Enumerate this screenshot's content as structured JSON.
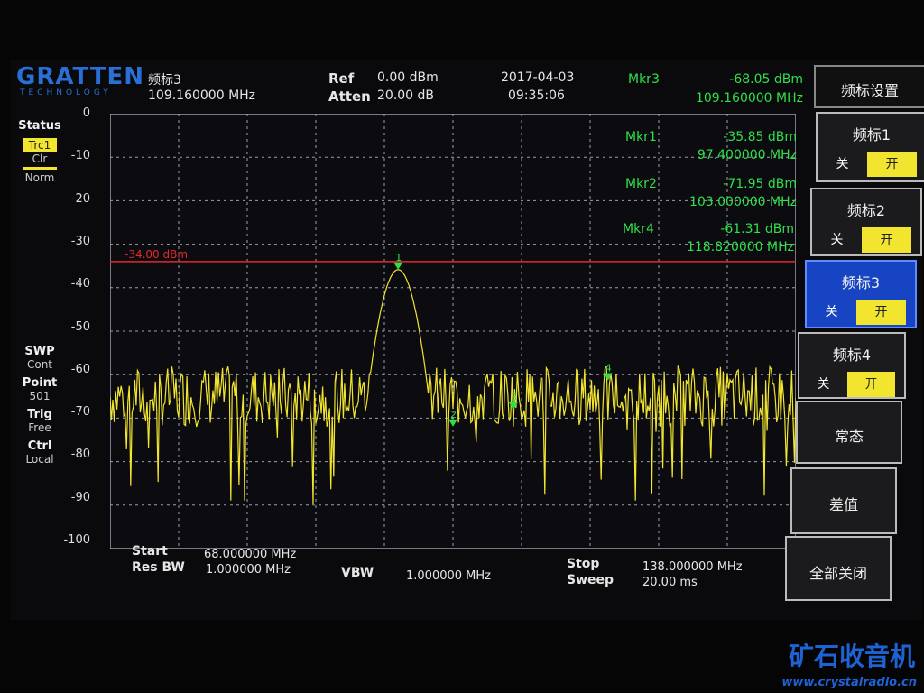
{
  "logo": {
    "main": "GRATTEN",
    "sub": "TECHNOLOGY"
  },
  "header": {
    "marker_name": "频标3",
    "marker_freq": "109.160000 MHz",
    "ref_label": "Ref",
    "ref_value": "0.00 dBm",
    "atten_label": "Atten",
    "atten_value": "20.00 dB",
    "date": "2017-04-03",
    "time": "09:35:06",
    "mkr3_label": "Mkr3",
    "mkr3_amp": "-68.05 dBm",
    "mkr3_freq": "109.160000 MHz"
  },
  "markers_table": [
    {
      "label": "Mkr1",
      "amp": "-35.85 dBm",
      "freq": "97.400000 MHz"
    },
    {
      "label": "Mkr2",
      "amp": "-71.95 dBm",
      "freq": "103.000000 MHz"
    },
    {
      "label": "Mkr4",
      "amp": "-61.31 dBm",
      "freq": "118.820000 MHz"
    }
  ],
  "left_panel": {
    "status": "Status",
    "trace": "Trc1",
    "clr": "Clr",
    "norm": "Norm",
    "swp_label": "SWP",
    "swp_value": "Cont",
    "point_label": "Point",
    "point_value": "501",
    "trig_label": "Trig",
    "trig_value": "Free",
    "ctrl_label": "Ctrl",
    "ctrl_value": "Local"
  },
  "y_ticks": [
    "0",
    "-10",
    "-20",
    "-30",
    "-40",
    "-50",
    "-60",
    "-70",
    "-80",
    "-90",
    "-100"
  ],
  "threshold_label": "-34.00 dBm",
  "footer": {
    "start_label": "Start",
    "start_value": "68.000000 MHz",
    "rbw_label": "Res BW",
    "rbw_value": "1.000000 MHz",
    "vbw_label": "VBW",
    "vbw_value": "1.000000 MHz",
    "stop_label": "Stop",
    "stop_value": "138.000000 MHz",
    "sweep_label": "Sweep",
    "sweep_value": "20.00 ms"
  },
  "softkeys": {
    "title": "频标设置",
    "m1": "频标1",
    "m2": "频标2",
    "m3": "频标3",
    "m4": "频标4",
    "off": "关",
    "on": "开",
    "normal": "常态",
    "delta": "差值",
    "all_off": "全部关闭"
  },
  "watermark": {
    "text": "矿石收音机",
    "url": "www.crystalradio.cn"
  },
  "chart_data": {
    "type": "line",
    "x_range_mhz": [
      68,
      138
    ],
    "ylim": [
      -100,
      0
    ],
    "grid": true,
    "threshold_dbm": -34,
    "markers": [
      {
        "n": "1",
        "freq_mhz": 97.4,
        "amp_dbm": -35.85
      },
      {
        "n": "2",
        "freq_mhz": 103.0,
        "amp_dbm": -71.95
      },
      {
        "n": "3",
        "freq_mhz": 109.16,
        "amp_dbm": -68.05
      },
      {
        "n": "4",
        "freq_mhz": 118.82,
        "amp_dbm": -61.31
      }
    ],
    "noise_floor_dbm": -65,
    "peak": {
      "freq_mhz": 97.4,
      "amp_dbm": -35.85
    }
  },
  "colors": {
    "trace": "#f2e530",
    "marker": "#2fe04a",
    "threshold": "#e02a2a",
    "grid": "#9aa0b0"
  }
}
